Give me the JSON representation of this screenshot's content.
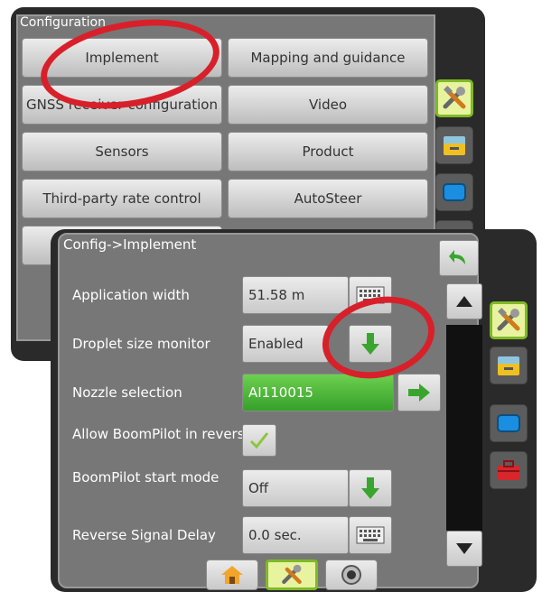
{
  "back": {
    "title": "Configuration",
    "buttons": [
      {
        "label": "Implement"
      },
      {
        "label": "Mapping and guidance"
      },
      {
        "label": "GNSS receiver configuration"
      },
      {
        "label": "Video"
      },
      {
        "label": "Sensors"
      },
      {
        "label": "Product"
      },
      {
        "label": "Third-party rate control"
      },
      {
        "label": "AutoSteer"
      }
    ]
  },
  "front": {
    "title": "Config->Implement",
    "rows": [
      {
        "label": "Application width",
        "value": "51.58 m",
        "action": "keyboard-icon"
      },
      {
        "label": "Droplet size monitor",
        "value": "Enabled",
        "action": "arrow-down-icon"
      },
      {
        "label": "Nozzle selection",
        "value": "AI110015",
        "action": "arrow-right-icon"
      },
      {
        "label": "Allow BoomPilot in reverse",
        "checked": true
      },
      {
        "label": "BoomPilot start mode",
        "value": "Off",
        "action": "arrow-down-icon"
      },
      {
        "label": "Reverse Signal Delay",
        "value": "0.0 sec.",
        "action": "keyboard-icon"
      }
    ]
  },
  "icons": {
    "side": [
      "tools-icon",
      "console-icon",
      "display-icon",
      "toolbox-icon"
    ],
    "nav": [
      "home-icon",
      "tools-icon",
      "gnss-icon"
    ],
    "back_button": "undo-arrow-icon"
  },
  "colors": {
    "selection_border": "#7fb927",
    "selection_fill": "#e8f3a0",
    "highlight_green": "#36a02a",
    "annotation_ring": "#d8202a"
  }
}
